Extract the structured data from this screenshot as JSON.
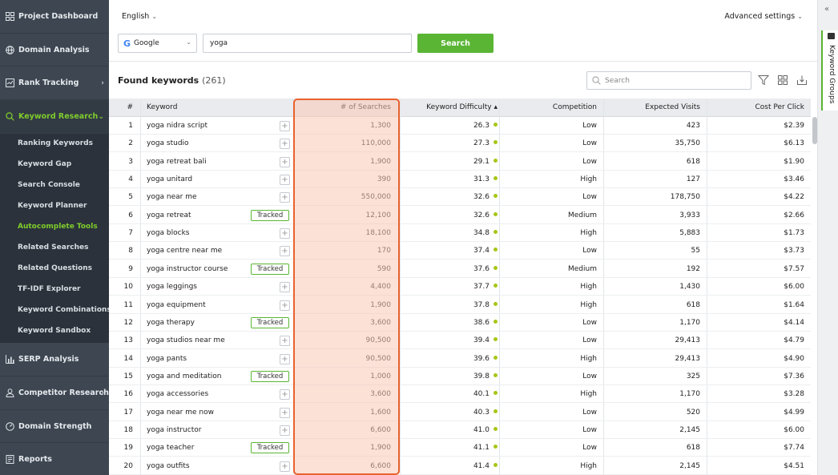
{
  "sidebar": {
    "items": [
      {
        "label": "Project Dashboard",
        "icon": "dashboard-grid-icon"
      },
      {
        "label": "Domain Analysis",
        "icon": "globe-icon"
      },
      {
        "label": "Rank Tracking",
        "icon": "chart-box-icon",
        "chevron": "›"
      },
      {
        "label": "Keyword Research",
        "icon": "search-icon",
        "chevron": "⌄",
        "active": true
      },
      {
        "label": "SERP Analysis",
        "icon": "bar-chart-icon"
      },
      {
        "label": "Competitor Research",
        "icon": "user-icon",
        "chevron": "›"
      },
      {
        "label": "Domain Strength",
        "icon": "gauge-icon"
      },
      {
        "label": "Reports",
        "icon": "report-icon"
      }
    ],
    "subitems": [
      "Ranking Keywords",
      "Keyword Gap",
      "Search Console",
      "Keyword Planner",
      "Autocomplete Tools",
      "Related Searches",
      "Related Questions",
      "TF-IDF Explorer",
      "Keyword Combinations",
      "Keyword Sandbox"
    ],
    "active_subitem": "Autocomplete Tools"
  },
  "topbar": {
    "language": "English",
    "advanced_settings": "Advanced settings",
    "engine": "Google",
    "query": "yoga",
    "search_button": "Search"
  },
  "results": {
    "title": "Found keywords",
    "count": "(261)",
    "search_placeholder": "Search"
  },
  "rail": {
    "groups_label": "Keyword Groups",
    "collapse": "«"
  },
  "table": {
    "columns": [
      "#",
      "Keyword",
      "# of Searches",
      "Keyword Difficulty ▴",
      "Competition",
      "Expected Visits",
      "Cost Per Click"
    ],
    "tracked_label": "Tracked",
    "rows": [
      {
        "n": "1",
        "keyword": "yoga nidra script",
        "tracked": false,
        "searches": "1,300",
        "kd": "26.3",
        "competition": "Low",
        "visits": "423",
        "cpc": "$2.39"
      },
      {
        "n": "2",
        "keyword": "yoga studio",
        "tracked": false,
        "searches": "110,000",
        "kd": "27.3",
        "competition": "Low",
        "visits": "35,750",
        "cpc": "$6.13"
      },
      {
        "n": "3",
        "keyword": "yoga retreat bali",
        "tracked": false,
        "searches": "1,900",
        "kd": "29.1",
        "competition": "Low",
        "visits": "618",
        "cpc": "$1.90"
      },
      {
        "n": "4",
        "keyword": "yoga unitard",
        "tracked": false,
        "searches": "390",
        "kd": "31.3",
        "competition": "High",
        "visits": "127",
        "cpc": "$3.46"
      },
      {
        "n": "5",
        "keyword": "yoga near me",
        "tracked": false,
        "searches": "550,000",
        "kd": "32.6",
        "competition": "Low",
        "visits": "178,750",
        "cpc": "$4.22"
      },
      {
        "n": "6",
        "keyword": "yoga retreat",
        "tracked": true,
        "searches": "12,100",
        "kd": "32.6",
        "competition": "Medium",
        "visits": "3,933",
        "cpc": "$2.66"
      },
      {
        "n": "7",
        "keyword": "yoga blocks",
        "tracked": false,
        "searches": "18,100",
        "kd": "34.8",
        "competition": "High",
        "visits": "5,883",
        "cpc": "$1.73"
      },
      {
        "n": "8",
        "keyword": "yoga centre near me",
        "tracked": false,
        "searches": "170",
        "kd": "37.4",
        "competition": "Low",
        "visits": "55",
        "cpc": "$3.73"
      },
      {
        "n": "9",
        "keyword": "yoga instructor course",
        "tracked": true,
        "searches": "590",
        "kd": "37.6",
        "competition": "Medium",
        "visits": "192",
        "cpc": "$7.57"
      },
      {
        "n": "10",
        "keyword": "yoga leggings",
        "tracked": false,
        "searches": "4,400",
        "kd": "37.7",
        "competition": "High",
        "visits": "1,430",
        "cpc": "$6.00"
      },
      {
        "n": "11",
        "keyword": "yoga equipment",
        "tracked": false,
        "searches": "1,900",
        "kd": "37.8",
        "competition": "High",
        "visits": "618",
        "cpc": "$1.64"
      },
      {
        "n": "12",
        "keyword": "yoga therapy",
        "tracked": true,
        "searches": "3,600",
        "kd": "38.6",
        "competition": "Low",
        "visits": "1,170",
        "cpc": "$4.14"
      },
      {
        "n": "13",
        "keyword": "yoga studios near me",
        "tracked": false,
        "searches": "90,500",
        "kd": "39.4",
        "competition": "Low",
        "visits": "29,413",
        "cpc": "$4.79"
      },
      {
        "n": "14",
        "keyword": "yoga pants",
        "tracked": false,
        "searches": "90,500",
        "kd": "39.6",
        "competition": "High",
        "visits": "29,413",
        "cpc": "$4.90"
      },
      {
        "n": "15",
        "keyword": "yoga and meditation",
        "tracked": true,
        "searches": "1,000",
        "kd": "39.8",
        "competition": "Low",
        "visits": "325",
        "cpc": "$7.36"
      },
      {
        "n": "16",
        "keyword": "yoga accessories",
        "tracked": false,
        "searches": "3,600",
        "kd": "40.1",
        "competition": "High",
        "visits": "1,170",
        "cpc": "$3.28"
      },
      {
        "n": "17",
        "keyword": "yoga near me now",
        "tracked": false,
        "searches": "1,600",
        "kd": "40.3",
        "competition": "Low",
        "visits": "520",
        "cpc": "$4.99"
      },
      {
        "n": "18",
        "keyword": "yoga instructor",
        "tracked": false,
        "searches": "6,600",
        "kd": "41.0",
        "competition": "Low",
        "visits": "2,145",
        "cpc": "$6.00"
      },
      {
        "n": "19",
        "keyword": "yoga teacher",
        "tracked": true,
        "searches": "1,900",
        "kd": "41.1",
        "competition": "Low",
        "visits": "618",
        "cpc": "$7.74"
      },
      {
        "n": "20",
        "keyword": "yoga outfits",
        "tracked": false,
        "searches": "6,600",
        "kd": "41.4",
        "competition": "High",
        "visits": "2,145",
        "cpc": "$4.51"
      }
    ]
  },
  "colors": {
    "accent": "#5ab534",
    "sidebar": "#3d4651",
    "highlight_border": "#e8622d",
    "kd_dot": "#a6c617"
  }
}
